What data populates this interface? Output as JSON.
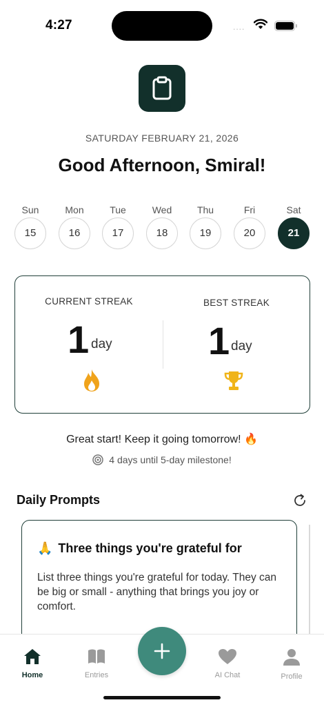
{
  "status": {
    "time": "4:27",
    "dots": "....",
    "icons": [
      "wifi-icon",
      "battery-icon"
    ]
  },
  "header": {
    "app_icon": "clipboard-icon",
    "date": "SATURDAY FEBRUARY 21, 2026",
    "greeting": "Good Afternoon, Smiral!"
  },
  "week": [
    {
      "name": "Sun",
      "date": "15"
    },
    {
      "name": "Mon",
      "date": "16"
    },
    {
      "name": "Tue",
      "date": "17"
    },
    {
      "name": "Wed",
      "date": "18"
    },
    {
      "name": "Thu",
      "date": "19"
    },
    {
      "name": "Fri",
      "date": "20"
    },
    {
      "name": "Sat",
      "date": "21",
      "selected": true
    }
  ],
  "streak": {
    "current": {
      "label": "CURRENT STREAK",
      "value": "1",
      "unit": "day",
      "icon": "flame-icon"
    },
    "best": {
      "label": "BEST STREAK",
      "value": "1",
      "unit": "day",
      "icon": "trophy-icon"
    }
  },
  "encouragement": "Great start! Keep it going tomorrow! 🔥",
  "milestone": "4 days until 5-day milestone!",
  "prompts": {
    "title": "Daily Prompts",
    "refresh_icon": "refresh-icon",
    "card": {
      "emoji": "🙏",
      "title": "Three things you're grateful for",
      "body": "List three things you're grateful for today. They can be big or small - anything that brings you joy or comfort."
    }
  },
  "tabs": [
    {
      "label": "Home",
      "icon": "home-icon",
      "active": true
    },
    {
      "label": "Entries",
      "icon": "book-icon"
    },
    {
      "label": "AI Chat",
      "icon": "heart-icon"
    },
    {
      "label": "Profile",
      "icon": "person-icon"
    }
  ],
  "fab_icon": "plus-icon",
  "colors": {
    "primary": "#12302b",
    "accent": "#3f8a7c",
    "flame": "#f0a31b",
    "trophy": "#f0b419"
  }
}
